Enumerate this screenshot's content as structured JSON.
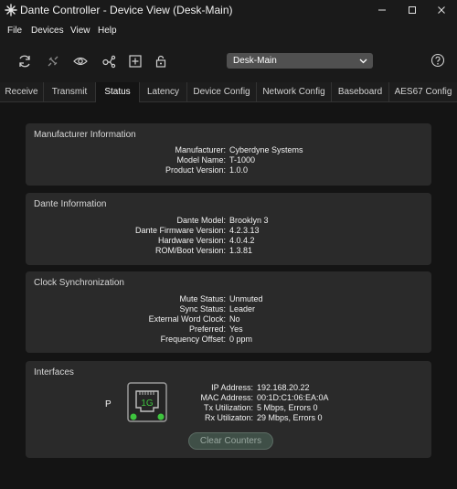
{
  "window": {
    "title": "Dante Controller - Device View (Desk-Main)",
    "app_icon": "dante-logo-icon",
    "controls": [
      "minimize-icon",
      "maximize-icon",
      "close-icon"
    ]
  },
  "menu": {
    "items": [
      {
        "label": "File"
      },
      {
        "label": "Devices"
      },
      {
        "label": "View"
      },
      {
        "label": "Help"
      }
    ]
  },
  "toolbar": {
    "icons": [
      "refresh-icon",
      "disconnect-icon",
      "eye-icon",
      "network-node-icon",
      "add-panel-icon",
      "lock-icon",
      "help-icon"
    ],
    "device_select": {
      "value": "Desk-Main"
    }
  },
  "tabs": {
    "items": [
      {
        "label": "Receive"
      },
      {
        "label": "Transmit"
      },
      {
        "label": "Status"
      },
      {
        "label": "Latency"
      },
      {
        "label": "Device Config"
      },
      {
        "label": "Network Config"
      },
      {
        "label": "Baseboard"
      },
      {
        "label": "AES67 Config"
      }
    ],
    "active": "Status"
  },
  "manufacturer": {
    "title": "Manufacturer Information",
    "rows": [
      {
        "key": "Manufacturer:",
        "value": "Cyberdyne Systems"
      },
      {
        "key": "Model Name:",
        "value": "T-1000"
      },
      {
        "key": "Product Version:",
        "value": "1.0.0"
      }
    ]
  },
  "dante": {
    "title": "Dante Information",
    "rows": [
      {
        "key": "Dante Model:",
        "value": "Brooklyn 3"
      },
      {
        "key": "Dante Firmware Version:",
        "value": "4.2.3.13"
      },
      {
        "key": "Hardware Version:",
        "value": "4.0.4.2"
      },
      {
        "key": "ROM/Boot Version:",
        "value": "1.3.81"
      }
    ]
  },
  "clock": {
    "title": "Clock Synchronization",
    "rows": [
      {
        "key": "Mute Status:",
        "value": "Unmuted"
      },
      {
        "key": "Sync Status:",
        "value": "Leader"
      },
      {
        "key": "External Word Clock:",
        "value": "No"
      },
      {
        "key": "Preferred:",
        "value": "Yes"
      },
      {
        "key": "Frequency Offset:",
        "value": "0 ppm"
      }
    ]
  },
  "interfaces": {
    "title": "Interfaces",
    "port_label": "P",
    "port_speed": "1G",
    "port_led_color": "#3ec43e",
    "rows": [
      {
        "key": "IP Address:",
        "value": "192.168.20.22"
      },
      {
        "key": "MAC Address:",
        "value": "00:1D:C1:06:EA:0A"
      },
      {
        "key": "Tx Utilization:",
        "value": "5 Mbps, Errors 0"
      },
      {
        "key": "Rx Utilizaton:",
        "value": "29 Mbps, Errors 0"
      }
    ],
    "clear_button": "Clear Counters"
  }
}
